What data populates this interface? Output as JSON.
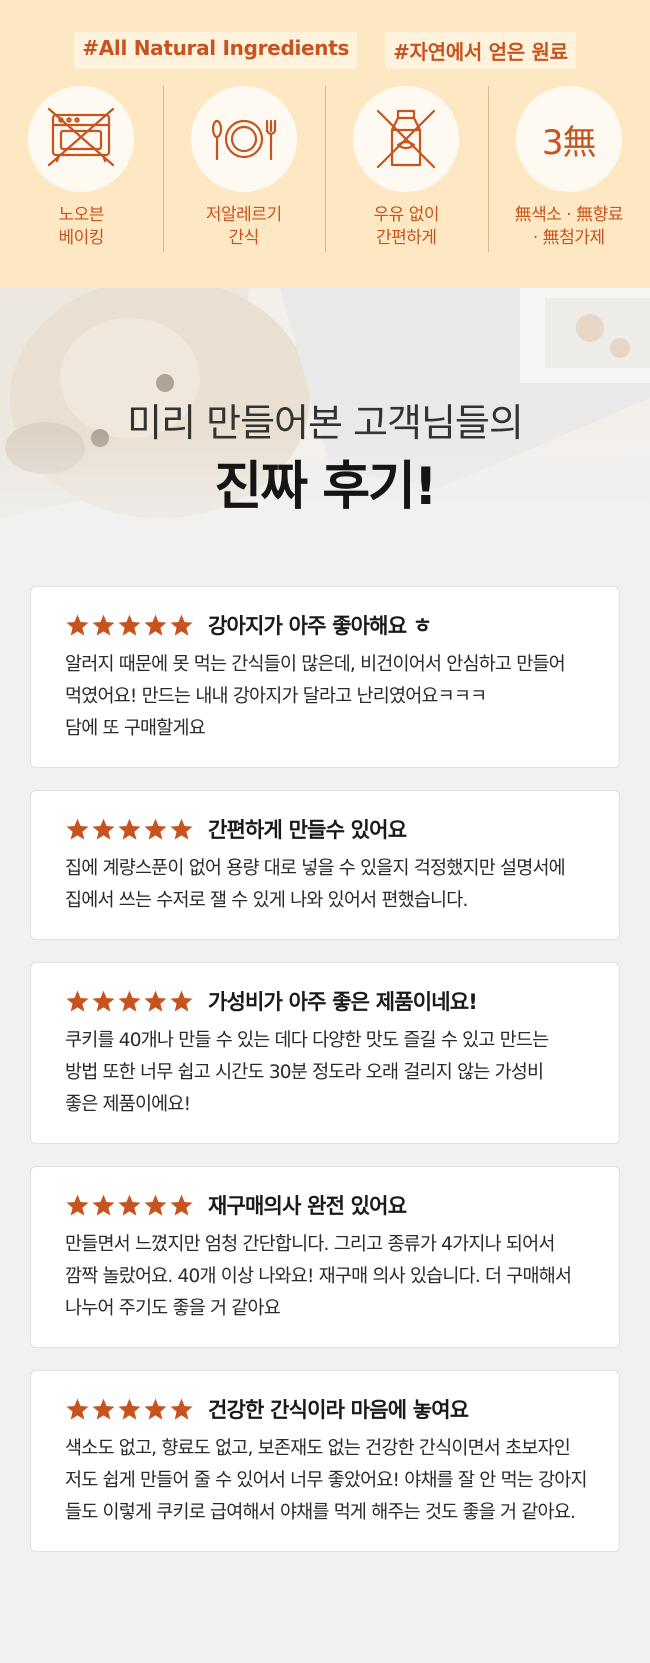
{
  "hashtags": [
    "#All Natural Ingredients",
    "#자연에서 얻은 원료"
  ],
  "features": [
    {
      "icon": "no-oven-icon",
      "label": "노오븐\n베이킹"
    },
    {
      "icon": "plate-cutlery-icon",
      "label": "저알레르기\n간식"
    },
    {
      "icon": "no-milk-icon",
      "label": "우유 없이\n간편하게"
    },
    {
      "icon": "three-mu-text",
      "circle_text": "3無",
      "label": "無색소 · 無향료\n· 無첨가제"
    }
  ],
  "hero": {
    "subtitle": "미리 만들어본 고객님들의",
    "title": "진짜 후기!"
  },
  "colors": {
    "accent": "#c7531f",
    "band": "#fde8c3",
    "page": "#f1f1f3"
  },
  "reviews": [
    {
      "rating": 5,
      "title": "강아지가 아주 좋아해요 ㅎ",
      "body": "알러지 때문에 못 먹는 간식들이 많은데, 비건이어서 안심하고 만들어\n먹였어요! 만드는 내내 강아지가 달라고 난리였어요ㅋㅋㅋ\n담에 또 구매할게요"
    },
    {
      "rating": 5,
      "title": "간편하게 만들수 있어요",
      "body": "집에 계량스푼이 없어 용량 대로 넣을 수 있을지 걱정했지만 설명서에\n집에서 쓰는 수저로 잴 수 있게 나와 있어서 편했습니다."
    },
    {
      "rating": 5,
      "title": "가성비가 아주 좋은 제품이네요!",
      "body": "쿠키를 40개나 만들 수 있는 데다 다양한 맛도 즐길 수 있고 만드는\n방법 또한 너무 쉽고 시간도 30분 정도라 오래 걸리지 않는 가성비\n좋은 제품이에요!"
    },
    {
      "rating": 5,
      "title": "재구매의사 완전 있어요",
      "body": "만들면서 느꼈지만 엄청 간단합니다. 그리고 종류가 4가지나 되어서\n깜짝 놀랐어요. 40개 이상 나와요! 재구매 의사 있습니다. 더 구매해서\n나누어 주기도 좋을 거 같아요"
    },
    {
      "rating": 5,
      "title": "건강한 간식이라 마음에 놓여요",
      "body": "색소도 없고, 향료도 없고, 보존재도 없는 건강한 간식이면서 초보자인\n저도 쉽게 만들어 줄 수 있어서 너무 좋았어요! 야채를 잘 안 먹는 강아지\n들도 이렇게 쿠키로 급여해서 야채를 먹게 해주는 것도 좋을 거 같아요."
    }
  ]
}
